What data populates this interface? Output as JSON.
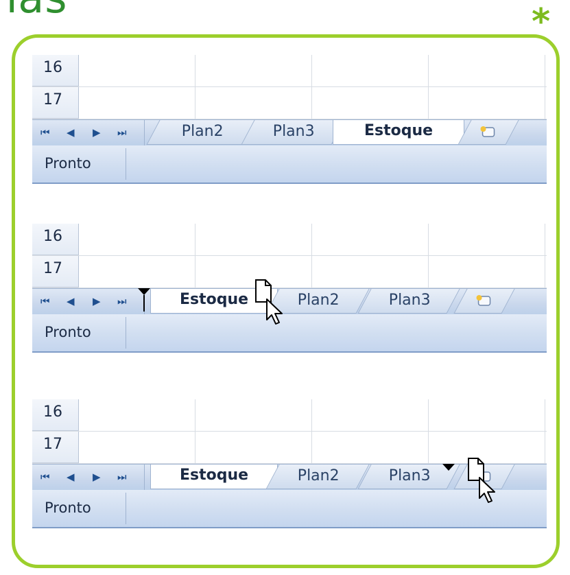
{
  "header": {
    "title_fragment": "nas",
    "asterisk": "*"
  },
  "panels": [
    {
      "rows": [
        "16",
        "17"
      ],
      "nav_buttons": [
        "⏮",
        "◀",
        "▶",
        "⏭"
      ],
      "tabs": [
        "Plan2",
        "Plan3",
        "Estoque"
      ],
      "active_tab": "Estoque",
      "status": "Pronto"
    },
    {
      "rows": [
        "16",
        "17"
      ],
      "nav_buttons": [
        "⏮",
        "◀",
        "▶",
        "⏭"
      ],
      "tabs": [
        "Estoque",
        "Plan2",
        "Plan3"
      ],
      "active_tab": "Estoque",
      "status": "Pronto"
    },
    {
      "rows": [
        "16",
        "17"
      ],
      "nav_buttons": [
        "⏮",
        "◀",
        "▶",
        "⏭"
      ],
      "tabs": [
        "Estoque",
        "Plan2",
        "Plan3"
      ],
      "active_tab": "Estoque",
      "status": "Pronto"
    }
  ],
  "colors": {
    "frame": "#9ccf2c",
    "header_text": "#2f8f2f",
    "tab_bar": "#c9d7ec",
    "status_bar": "#d2dff1"
  },
  "icons": {
    "new_sheet": "insert-worksheet-icon",
    "drag_cursor": "drag-sheet-cursor-icon",
    "drop_marker": "drop-position-marker-icon"
  }
}
